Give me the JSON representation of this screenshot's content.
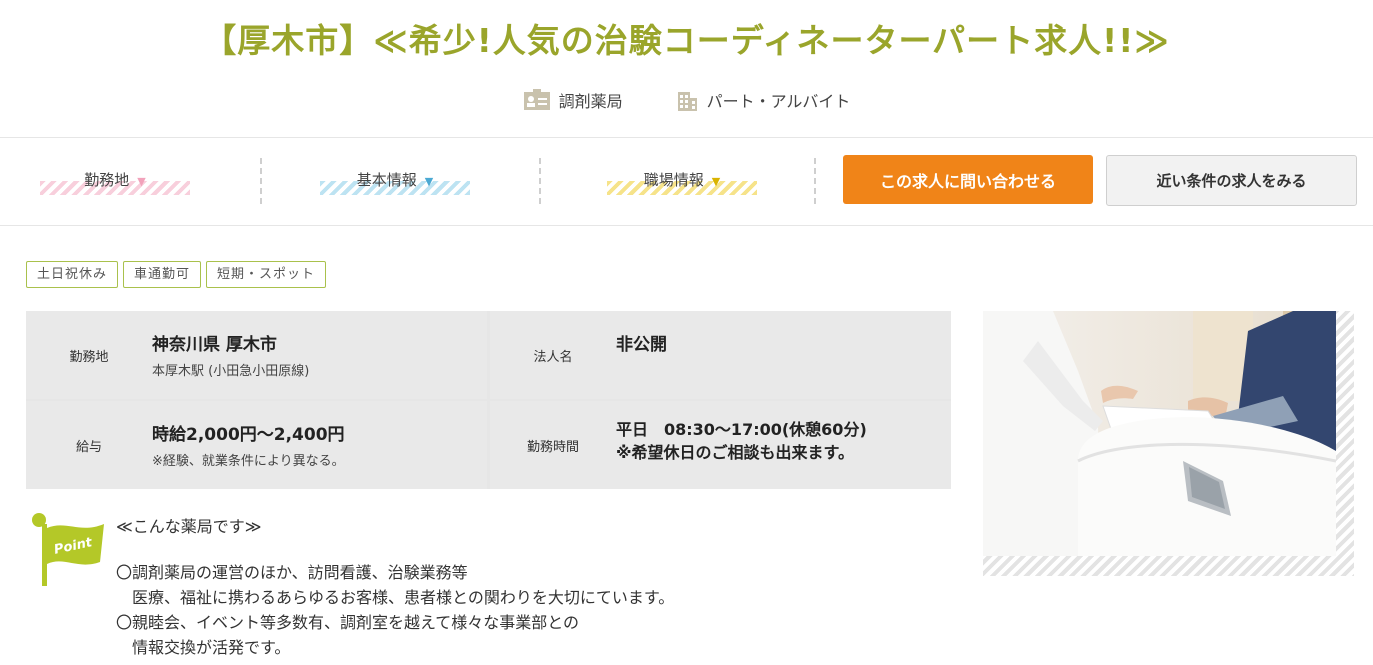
{
  "title": "【厚木市】≪希少!人気の治験コーディネーターパート求人!!≫",
  "categories": [
    {
      "icon": "id-card-icon",
      "label": "調剤薬局"
    },
    {
      "icon": "building-icon",
      "label": "パート・アルバイト"
    }
  ],
  "nav": {
    "items": [
      {
        "label": "勤務地",
        "marker": "▼",
        "color": "#f2a2bb"
      },
      {
        "label": "基本情報",
        "marker": "▼",
        "color": "#6cc1e0"
      },
      {
        "label": "職場情報",
        "marker": "▼",
        "color": "#e9c415"
      }
    ],
    "contact_button": "この求人に問い合わせる",
    "similar_button": "近い条件の求人をみる"
  },
  "tags": [
    "土日祝休み",
    "車通勤可",
    "短期・スポット"
  ],
  "info": {
    "location": {
      "label": "勤務地",
      "value": "神奈川県 厚木市",
      "sub": "本厚木駅 (小田急小田原線)"
    },
    "company": {
      "label": "法人名",
      "value": "非公開"
    },
    "salary": {
      "label": "給与",
      "value": "時給2,000円〜2,400円",
      "sub": "※経験、就業条件により異なる。"
    },
    "hours": {
      "label": "勤務時間",
      "line1": "平日　08:30〜17:00(休憩60分)",
      "line2": "※希望休日のご相談も出来ます。"
    }
  },
  "pr": {
    "flag_text": "Point",
    "title": "≪こんな薬局です≫",
    "lines": [
      "〇調剤薬局の運営のほか、訪問看護、治験業務等",
      "　医療、福祉に携わるあらゆるお客様、患者様との関わりを大切にています。",
      "〇親睦会、イベント等多数有、調剤室を越えて様々な事業部との",
      "　情報交換が活発です。"
    ]
  },
  "colors": {
    "title": "#9aa52b",
    "accent_orange": "#f08418",
    "tag_border": "#a9c14c",
    "flag": "#b4c828"
  }
}
